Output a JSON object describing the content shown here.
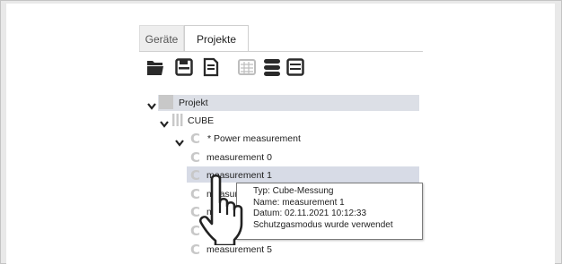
{
  "tabs": [
    {
      "label": "Geräte",
      "active": false
    },
    {
      "label": "Projekte",
      "active": true
    }
  ],
  "toolbar": {
    "icons": [
      "folder-open-icon",
      "save-icon",
      "document-icon",
      "table-icon",
      "database-icon",
      "list-icon"
    ]
  },
  "tree": {
    "root": {
      "label": "Projekt",
      "expanded": true
    },
    "cube": {
      "label": "CUBE",
      "expanded": true
    },
    "power": {
      "label": "*  Power measurement",
      "expanded": true
    },
    "items": [
      {
        "label": "measurement 0",
        "selected": false
      },
      {
        "label": "measurement 1",
        "selected": true
      },
      {
        "label": "measure",
        "selected": false
      },
      {
        "label": "m",
        "selected": false
      },
      {
        "label": "m",
        "selected": false
      },
      {
        "label": "measurement 5",
        "selected": false
      }
    ]
  },
  "tooltip": {
    "type_line": "Typ: Cube-Messung",
    "name_line": "Name: measurement 1",
    "date_line": "Datum: 02.11.2021 10:12:33",
    "note_line": "Schutzgasmodus wurde verwendet"
  },
  "colors": {
    "selection": "#d7dbe6",
    "header_row": "#dcdfe6",
    "icon_gray": "#c8c8c8",
    "icon_dark": "#2a2a2a"
  }
}
